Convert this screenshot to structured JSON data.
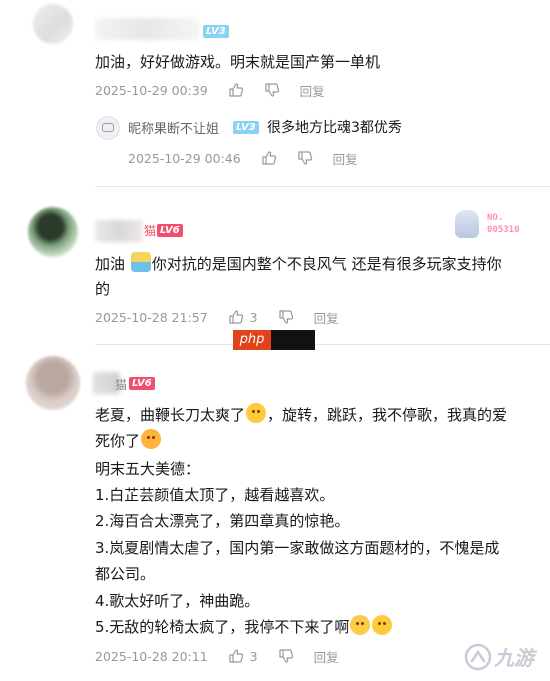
{
  "comments": [
    {
      "level": "LV3",
      "text": "加油，好好做游戏。明末就是国产第一单机",
      "time": "2025-10-29 00:39",
      "reply_label": "回复",
      "reply": {
        "user": "昵称果断不让姐",
        "level": "LV3",
        "text": "很多地方比魂3都优秀",
        "time": "2025-10-29 00:46",
        "reply_label": "回复"
      }
    },
    {
      "name_fragment": "猫",
      "level": "LV6",
      "badge_top": "NO.",
      "badge_num": "005310",
      "text_line1_pre": "加油",
      "text_line1_post": "你对抗的是国内整个不良风气 还是有很多玩家支持你",
      "text_line2": "的",
      "time": "2025-10-28 21:57",
      "likes": "3",
      "reply_label": "回复"
    },
    {
      "name_fragment": "猫",
      "level": "LV6",
      "lines": [
        "老夏，曲鞭长刀太爽了",
        "，旋转，跳跃，我不停歌，我真的爱",
        "死你了",
        "明末五大美德：",
        "1.白芷芸颜值太顶了，越看越喜欢。",
        "2.海百合太漂亮了，第四章真的惊艳。",
        "3.岚夏剧情太虐了，国内第一家敢做这方面题材的，不愧是成",
        "都公司。",
        "4.歌太好听了，神曲跪。",
        "5.无敌的轮椅太疯了，我停不下来了啊"
      ],
      "time": "2025-10-28 20:11",
      "likes": "3",
      "reply_label": "回复"
    }
  ],
  "watermark_php": "php",
  "watermark_site": "九游",
  "colors": {
    "muted": "#9499a0",
    "text": "#18191c",
    "lv3": "#86d4f2",
    "lv6": "#f0506e"
  },
  "icons": [
    "thumb-up-icon",
    "thumb-down-icon",
    "emoji-icon"
  ]
}
